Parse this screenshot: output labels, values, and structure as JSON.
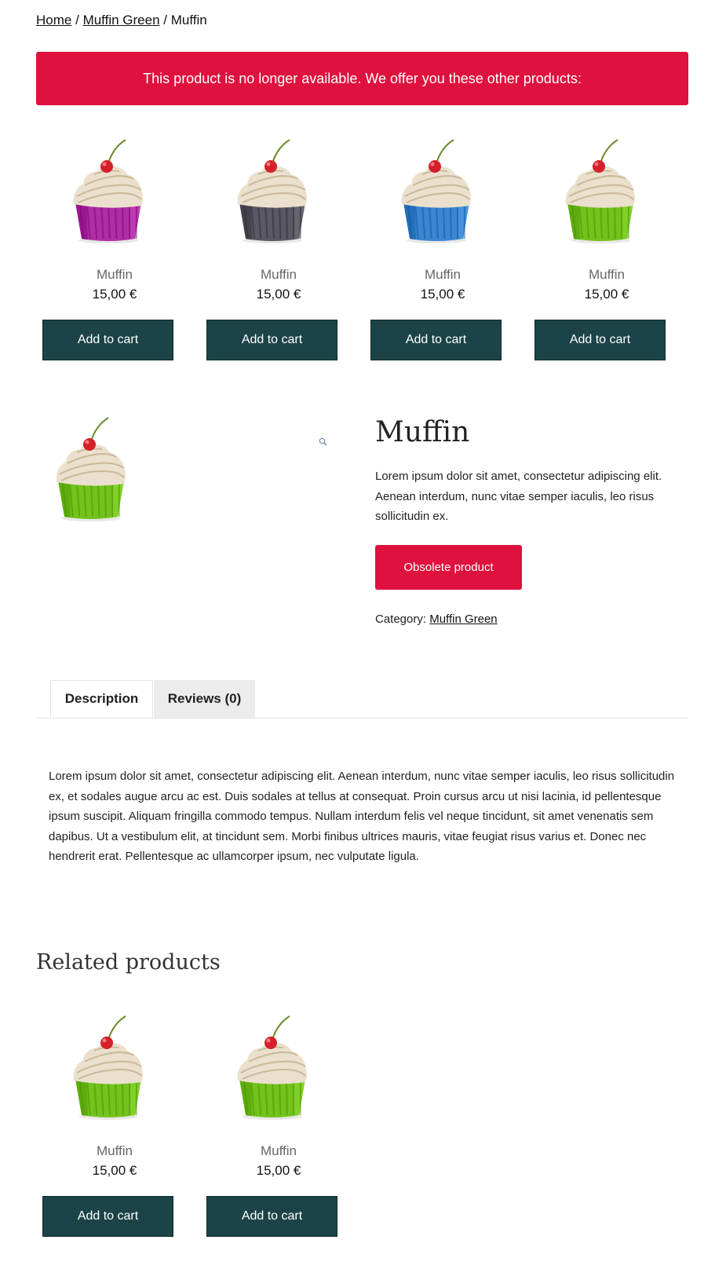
{
  "breadcrumb": {
    "home": "Home",
    "sep1": "/",
    "category": "Muffin Green",
    "sep2": "/",
    "current": "Muffin"
  },
  "notice": "This product is no longer available. We offer you these other products:",
  "alternatives": [
    {
      "name": "Muffin",
      "price": "15,00 €",
      "button": "Add to cart",
      "color": "#b02ea4",
      "icon": "muffin-purple"
    },
    {
      "name": "Muffin",
      "price": "15,00 €",
      "button": "Add to cart",
      "color": "#5a5862",
      "icon": "muffin-gray"
    },
    {
      "name": "Muffin",
      "price": "15,00 €",
      "button": "Add to cart",
      "color": "#3a86cf",
      "icon": "muffin-blue"
    },
    {
      "name": "Muffin",
      "price": "15,00 €",
      "button": "Add to cart",
      "color": "#74c21c",
      "icon": "muffin-green"
    }
  ],
  "product": {
    "title": "Muffin",
    "description": "Lorem ipsum dolor sit amet, consectetur adipiscing elit. Aenean interdum, nunc vitae semper iaculis, leo risus sollicitudin ex.",
    "obsolete_button": "Obsolete product",
    "category_label": "Category:",
    "category_link": "Muffin Green",
    "image_color": "#74c21c",
    "zoom_icon": "magnifier-icon"
  },
  "tabs": [
    {
      "label": "Description",
      "active": true
    },
    {
      "label": "Reviews (0)",
      "active": false
    }
  ],
  "long_description": "Lorem ipsum dolor sit amet, consectetur adipiscing elit. Aenean interdum, nunc vitae semper iaculis, leo risus sollicitudin ex, et sodales augue arcu ac est. Duis sodales at tellus at consequat. Proin cursus arcu ut nisi lacinia, id pellentesque ipsum suscipit. Aliquam fringilla commodo tempus. Nullam interdum felis vel neque tincidunt, sit amet venenatis sem dapibus. Ut a vestibulum elit, at tincidunt sem. Morbi finibus ultrices mauris, vitae feugiat risus varius et. Donec nec hendrerit erat. Pellentesque ac ullamcorper ipsum, nec vulputate ligula.",
  "related": {
    "title": "Related products",
    "items": [
      {
        "name": "Muffin",
        "price": "15,00 €",
        "button": "Add to cart",
        "color": "#74c21c",
        "icon": "muffin-green"
      },
      {
        "name": "Muffin",
        "price": "15,00 €",
        "button": "Add to cart",
        "color": "#74c21c",
        "icon": "muffin-green"
      }
    ]
  },
  "colors": {
    "alert_red": "#df113e",
    "button_teal": "#1c4448"
  }
}
